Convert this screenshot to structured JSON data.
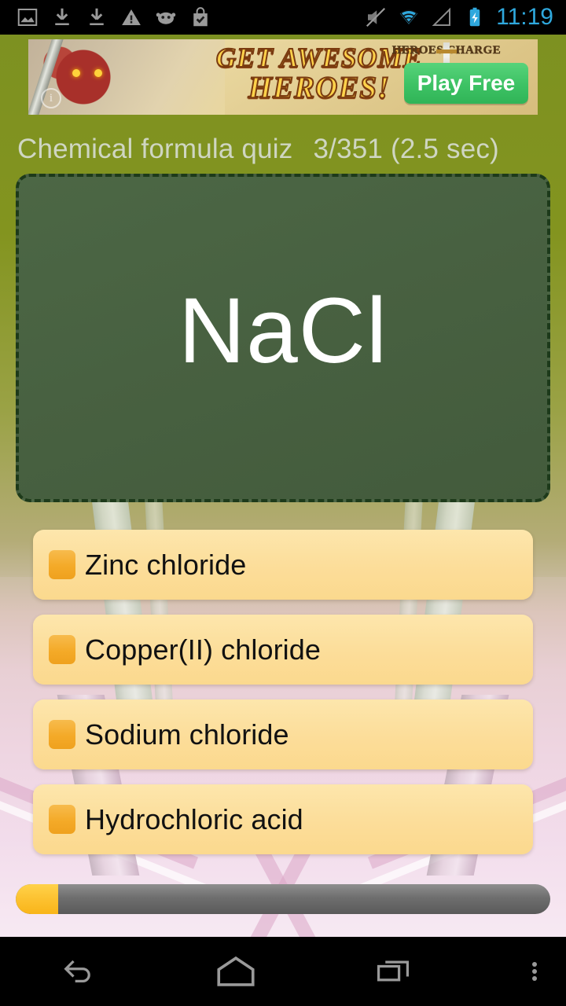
{
  "status_bar": {
    "left_icons": [
      "image-icon",
      "download-icon",
      "download-icon",
      "warning-icon",
      "android-icon",
      "play-store-bag-icon"
    ],
    "right_icons": [
      "mute-icon",
      "wifi-icon",
      "signal-icon",
      "battery-charging-icon"
    ],
    "clock": "11:19",
    "clock_color": "#2fa8dd"
  },
  "ad": {
    "line1": "GET AWESOME",
    "line2": "HEROES!",
    "logo_text": "HEROES CHARGE",
    "cta_label": "Play Free",
    "info_glyph": "i",
    "cta_color": "#3dc264"
  },
  "quiz": {
    "title": "Chemical formula quiz",
    "progress_text": "3/351 (2.5 sec)",
    "formula": "NaCl",
    "board_color": "#486141",
    "board_border_color": "#1d3a1a",
    "answers": [
      {
        "label": "Zinc chloride"
      },
      {
        "label": "Copper(II) chloride"
      },
      {
        "label": "Sodium chloride"
      },
      {
        "label": "Hydrochloric acid"
      }
    ],
    "progress_bar": {
      "percent": "8%",
      "fill_color": "#fcc02e",
      "track_color": "#6e6e6e"
    }
  },
  "nav_bar": {
    "buttons": [
      "back-button",
      "home-button",
      "recents-button",
      "overflow-menu-button"
    ]
  }
}
